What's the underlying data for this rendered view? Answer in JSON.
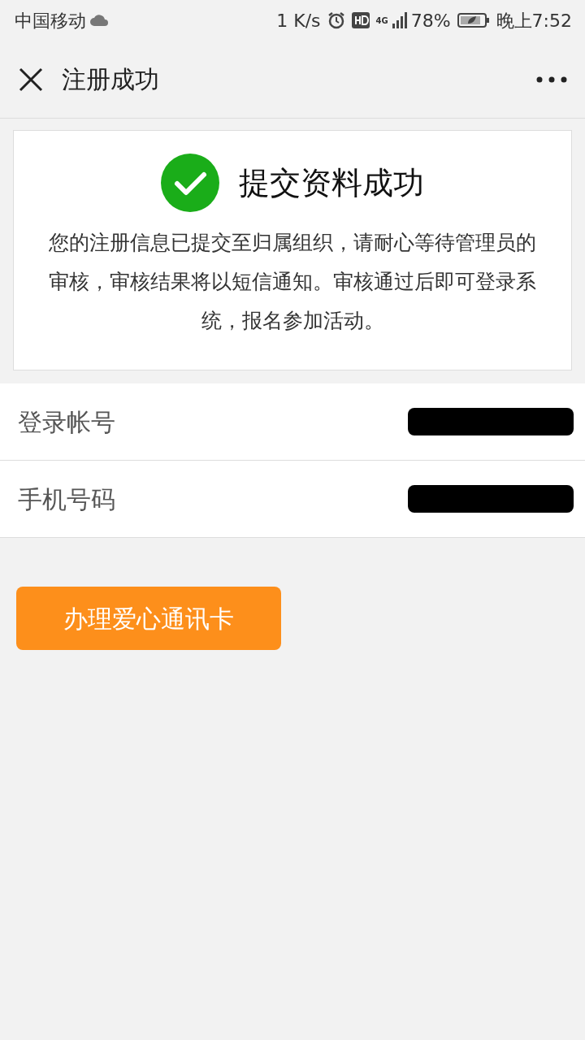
{
  "status_bar": {
    "carrier": "中国移动",
    "speed": "1 K/s",
    "network": "4G",
    "battery": "78%",
    "time": "晚上7:52"
  },
  "nav": {
    "title": "注册成功"
  },
  "result": {
    "title": "提交资料成功",
    "message": "您的注册信息已提交至归属组织，请耐心等待管理员的审核，审核结果将以短信通知。审核通过后即可登录系统，报名参加活动。"
  },
  "fields": [
    {
      "label": "登录帐号",
      "redacted": true
    },
    {
      "label": "手机号码",
      "redacted": true
    }
  ],
  "action_button": {
    "label": "办理爱心通讯卡"
  }
}
